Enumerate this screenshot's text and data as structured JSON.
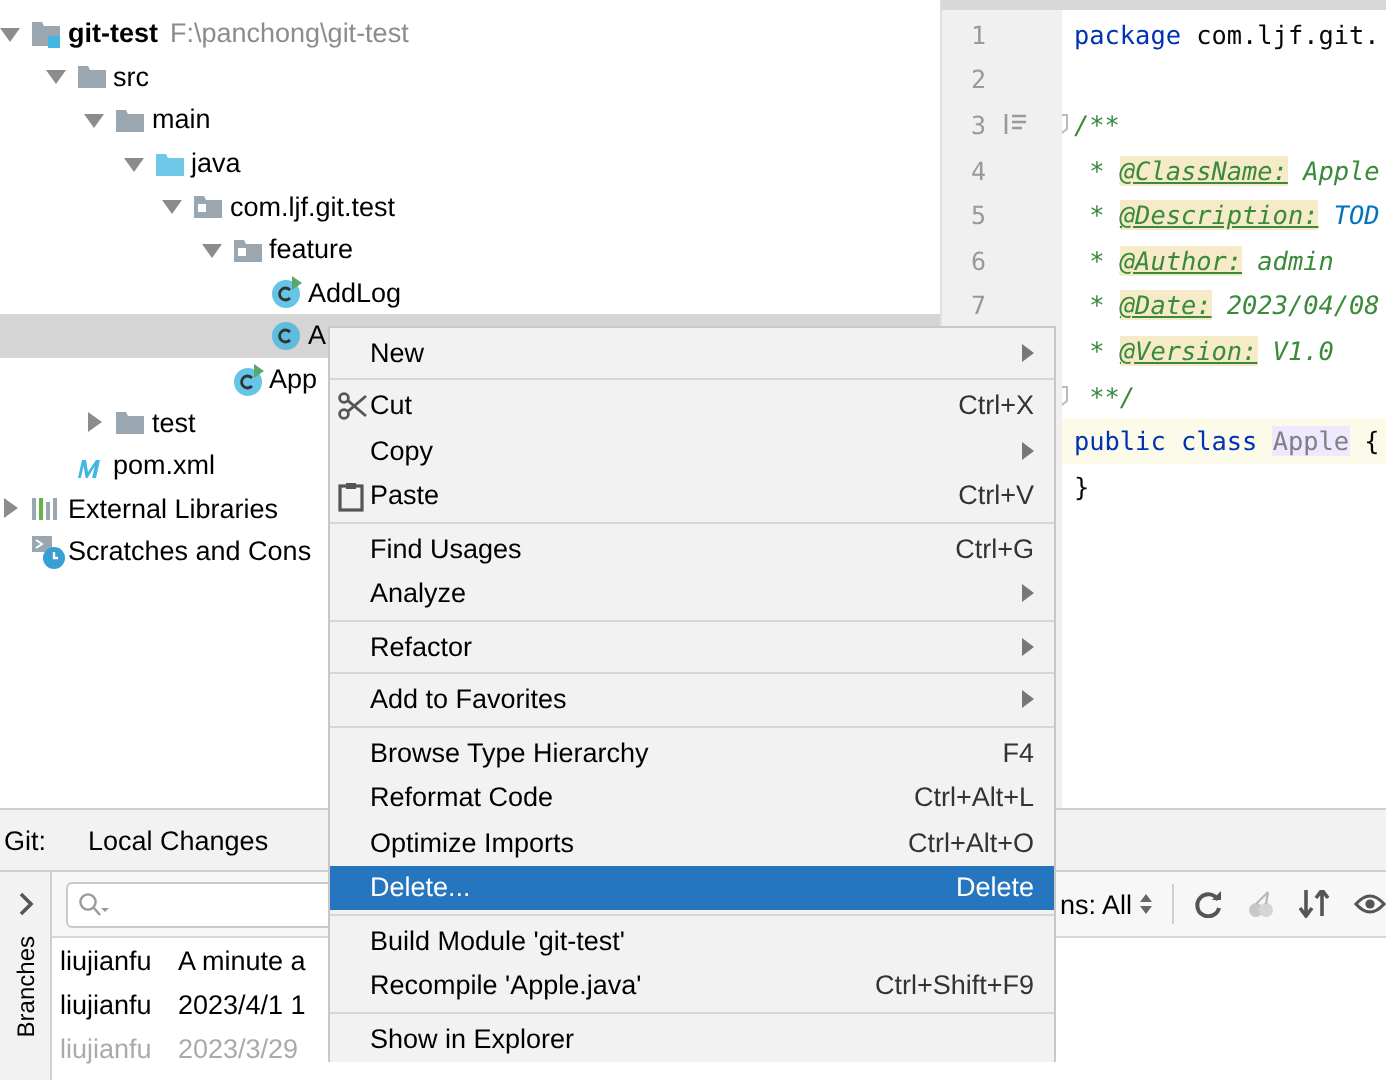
{
  "project_tree": [
    {
      "label": "git-test",
      "path": "F:\\panchong\\git-test",
      "kind": "module",
      "expanded": true,
      "selected": false,
      "children": [
        {
          "label": "src",
          "kind": "folder",
          "expanded": true,
          "selected": false,
          "children": [
            {
              "label": "main",
              "kind": "folder",
              "expanded": true,
              "selected": false,
              "children": [
                {
                  "label": "java",
                  "kind": "source-root",
                  "expanded": true,
                  "selected": false,
                  "children": [
                    {
                      "label": "com.ljf.git.test",
                      "kind": "package",
                      "expanded": true,
                      "selected": false,
                      "children": [
                        {
                          "label": "feature",
                          "kind": "package",
                          "expanded": true,
                          "selected": false,
                          "children": [
                            {
                              "label": "AddLog",
                              "kind": "runnable-class",
                              "selected": false
                            },
                            {
                              "label": "A",
                              "kind": "class",
                              "selected": true
                            }
                          ]
                        },
                        {
                          "label": "App",
                          "kind": "runnable-class",
                          "selected": false
                        }
                      ]
                    }
                  ]
                }
              ]
            },
            {
              "label": "test",
              "kind": "folder",
              "expanded": false,
              "selected": false
            }
          ]
        },
        {
          "label": "pom.xml",
          "kind": "maven-file",
          "selected": false
        }
      ]
    },
    {
      "label": "External Libraries",
      "kind": "libraries",
      "expanded": false,
      "selected": false
    },
    {
      "label": "Scratches and Cons",
      "kind": "scratches",
      "selected": false
    }
  ],
  "editor": {
    "lines": [
      {
        "number": "1",
        "current": false,
        "fold_marker": false,
        "doc_toggle": false,
        "tokens": [
          {
            "kind": "keyword",
            "text": "package"
          },
          {
            "kind": "plain",
            "text": " com.ljf.git."
          }
        ]
      },
      {
        "number": "2",
        "current": false,
        "fold_marker": false,
        "doc_toggle": false
      },
      {
        "number": "3",
        "current": false,
        "fold_marker": true,
        "doc_toggle": true,
        "tokens": [
          {
            "kind": "doc",
            "text": "/**"
          }
        ]
      },
      {
        "number": "4",
        "current": false,
        "fold_marker": false,
        "doc_toggle": false,
        "tokens": [
          {
            "kind": "doc",
            "text": " * "
          },
          {
            "kind": "doctag",
            "text": "@ClassName:"
          },
          {
            "kind": "doc",
            "text": " Apple"
          }
        ]
      },
      {
        "number": "5",
        "current": false,
        "fold_marker": false,
        "doc_toggle": false,
        "tokens": [
          {
            "kind": "doc",
            "text": " * "
          },
          {
            "kind": "doctag",
            "text": "@Description:"
          },
          {
            "kind": "todo",
            "text": " TOD"
          }
        ]
      },
      {
        "number": "6",
        "current": false,
        "fold_marker": false,
        "doc_toggle": false,
        "tokens": [
          {
            "kind": "doc",
            "text": " * "
          },
          {
            "kind": "doctag",
            "text": "@Author:"
          },
          {
            "kind": "doc",
            "text": " admin"
          }
        ]
      },
      {
        "number": "7",
        "current": false,
        "fold_marker": false,
        "doc_toggle": false,
        "tokens": [
          {
            "kind": "doc",
            "text": " * "
          },
          {
            "kind": "doctag",
            "text": "@Date:"
          },
          {
            "kind": "doc",
            "text": " 2023/04/08"
          }
        ]
      },
      {
        "current": false,
        "fold_marker": false,
        "tokens": [
          {
            "kind": "doc",
            "text": " * "
          },
          {
            "kind": "doctag",
            "text": "@Version:"
          },
          {
            "kind": "doc",
            "text": " V1.0"
          }
        ]
      },
      {
        "current": false,
        "fold_marker": true,
        "tokens": [
          {
            "kind": "doc",
            "text": " **/"
          }
        ]
      },
      {
        "current": true,
        "fold_marker": false,
        "tokens": [
          {
            "kind": "keyword",
            "text": "public class "
          },
          {
            "kind": "unused",
            "text": "Apple"
          },
          {
            "kind": "plain",
            "text": " {"
          }
        ]
      },
      {
        "current": false,
        "fold_marker": false,
        "tokens": [
          {
            "kind": "plain",
            "text": "}"
          }
        ]
      }
    ]
  },
  "git_panel": {
    "title": "Git:",
    "tab": "Local Changes",
    "side_tab": "Branches",
    "filter": {
      "label": "ns: All"
    },
    "log_rows": [
      {
        "author": "liujianfu",
        "date": "A minute a",
        "dimmed": false
      },
      {
        "author": "liujianfu",
        "date": "2023/4/1 1",
        "dimmed": false
      },
      {
        "author": "liujianfu",
        "date": "2023/3/29",
        "dimmed": true
      }
    ]
  },
  "context_menu": [
    {
      "kind": "action",
      "label": "New",
      "submenu": true,
      "selected": false
    },
    {
      "kind": "separator"
    },
    {
      "kind": "cut",
      "label": "Cut",
      "shortcut": "Ctrl+X",
      "submenu": false,
      "selected": false
    },
    {
      "kind": "action",
      "label": "Copy",
      "submenu": true,
      "selected": false
    },
    {
      "kind": "paste",
      "label": "Paste",
      "shortcut": "Ctrl+V",
      "submenu": false,
      "selected": false
    },
    {
      "kind": "separator"
    },
    {
      "kind": "action",
      "label": "Find Usages",
      "shortcut": "Ctrl+G",
      "submenu": false,
      "selected": false
    },
    {
      "kind": "action",
      "label": "Analyze",
      "submenu": true,
      "selected": false
    },
    {
      "kind": "separator"
    },
    {
      "kind": "action",
      "label": "Refactor",
      "submenu": true,
      "selected": false
    },
    {
      "kind": "separator"
    },
    {
      "kind": "action",
      "label": "Add to Favorites",
      "submenu": true,
      "selected": false
    },
    {
      "kind": "separator"
    },
    {
      "kind": "action",
      "label": "Browse Type Hierarchy",
      "shortcut": "F4",
      "submenu": false,
      "selected": false
    },
    {
      "kind": "action",
      "label": "Reformat Code",
      "shortcut": "Ctrl+Alt+L",
      "submenu": false,
      "selected": false
    },
    {
      "kind": "action",
      "label": "Optimize Imports",
      "shortcut": "Ctrl+Alt+O",
      "submenu": false,
      "selected": false
    },
    {
      "kind": "action",
      "label": "Delete...",
      "shortcut": "Delete",
      "submenu": false,
      "selected": true
    },
    {
      "kind": "separator"
    },
    {
      "kind": "action",
      "label": "Build Module 'git-test'",
      "submenu": false,
      "selected": false
    },
    {
      "kind": "action",
      "label": "Recompile 'Apple.java'",
      "shortcut": "Ctrl+Shift+F9",
      "submenu": false,
      "selected": false
    },
    {
      "kind": "separator"
    },
    {
      "kind": "action",
      "label": "Show in Explorer",
      "submenu": false,
      "selected": false
    }
  ]
}
